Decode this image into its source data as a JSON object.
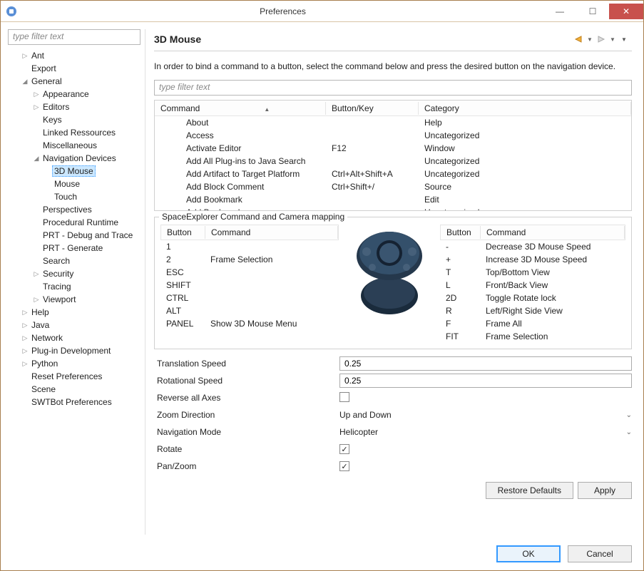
{
  "window": {
    "title": "Preferences"
  },
  "sidebar": {
    "filter_placeholder": "type filter text",
    "items": [
      {
        "label": "Ant",
        "indent": 1,
        "arrow": "▷"
      },
      {
        "label": "Export",
        "indent": 1,
        "arrow": ""
      },
      {
        "label": "General",
        "indent": 1,
        "arrow": "◢"
      },
      {
        "label": "Appearance",
        "indent": 2,
        "arrow": "▷"
      },
      {
        "label": "Editors",
        "indent": 2,
        "arrow": "▷"
      },
      {
        "label": "Keys",
        "indent": 2,
        "arrow": ""
      },
      {
        "label": "Linked Ressources",
        "indent": 2,
        "arrow": ""
      },
      {
        "label": "Miscellaneous",
        "indent": 2,
        "arrow": ""
      },
      {
        "label": "Navigation Devices",
        "indent": 2,
        "arrow": "◢"
      },
      {
        "label": "3D Mouse",
        "indent": 3,
        "arrow": "",
        "selected": true
      },
      {
        "label": "Mouse",
        "indent": 3,
        "arrow": ""
      },
      {
        "label": "Touch",
        "indent": 3,
        "arrow": ""
      },
      {
        "label": "Perspectives",
        "indent": 2,
        "arrow": ""
      },
      {
        "label": "Procedural Runtime",
        "indent": 2,
        "arrow": ""
      },
      {
        "label": "PRT - Debug and Trace",
        "indent": 2,
        "arrow": ""
      },
      {
        "label": "PRT - Generate",
        "indent": 2,
        "arrow": ""
      },
      {
        "label": "Search",
        "indent": 2,
        "arrow": ""
      },
      {
        "label": "Security",
        "indent": 2,
        "arrow": "▷"
      },
      {
        "label": "Tracing",
        "indent": 2,
        "arrow": ""
      },
      {
        "label": "Viewport",
        "indent": 2,
        "arrow": "▷"
      },
      {
        "label": "Help",
        "indent": 1,
        "arrow": "▷"
      },
      {
        "label": "Java",
        "indent": 1,
        "arrow": "▷"
      },
      {
        "label": "Network",
        "indent": 1,
        "arrow": "▷"
      },
      {
        "label": "Plug-in Development",
        "indent": 1,
        "arrow": "▷"
      },
      {
        "label": "Python",
        "indent": 1,
        "arrow": "▷"
      },
      {
        "label": "Reset Preferences",
        "indent": 1,
        "arrow": ""
      },
      {
        "label": "Scene",
        "indent": 1,
        "arrow": ""
      },
      {
        "label": "SWTBot Preferences",
        "indent": 1,
        "arrow": ""
      }
    ]
  },
  "page": {
    "title": "3D Mouse",
    "instructions": "In order to bind a command to a button, select the command below and press the desired button on the navigation device.",
    "filter_placeholder": "type filter text",
    "commands": {
      "headers": {
        "a": "Command",
        "b": "Button/Key",
        "c": "Category"
      },
      "rows": [
        {
          "a": "About",
          "b": "",
          "c": "Help"
        },
        {
          "a": "Access",
          "b": "",
          "c": "Uncategorized"
        },
        {
          "a": "Activate Editor",
          "b": "F12",
          "c": "Window"
        },
        {
          "a": "Add All Plug-ins to Java Search",
          "b": "",
          "c": "Uncategorized"
        },
        {
          "a": "Add Artifact to Target Platform",
          "b": "Ctrl+Alt+Shift+A",
          "c": "Uncategorized"
        },
        {
          "a": "Add Block Comment",
          "b": "Ctrl+Shift+/",
          "c": "Source"
        },
        {
          "a": "Add Bookmark",
          "b": "",
          "c": "Edit"
        },
        {
          "a": "Add Bookmark",
          "b": "",
          "c": "Uncategorized"
        }
      ]
    },
    "mapping": {
      "title": "SpaceExplorer Command and Camera mapping",
      "left": {
        "headers": {
          "a": "Button",
          "b": "Command"
        },
        "rows": [
          {
            "a": "1",
            "b": ""
          },
          {
            "a": "2",
            "b": "Frame Selection"
          },
          {
            "a": "ESC",
            "b": ""
          },
          {
            "a": "SHIFT",
            "b": ""
          },
          {
            "a": "CTRL",
            "b": ""
          },
          {
            "a": "ALT",
            "b": ""
          },
          {
            "a": "PANEL",
            "b": "Show 3D Mouse Menu"
          }
        ]
      },
      "right": {
        "headers": {
          "a": "Button",
          "b": "Command"
        },
        "rows": [
          {
            "a": "-",
            "b": "Decrease 3D Mouse Speed"
          },
          {
            "a": "+",
            "b": "Increase 3D Mouse Speed"
          },
          {
            "a": "T",
            "b": "Top/Bottom View"
          },
          {
            "a": "L",
            "b": "Front/Back View"
          },
          {
            "a": "2D",
            "b": "Toggle Rotate lock"
          },
          {
            "a": "R",
            "b": "Left/Right Side View"
          },
          {
            "a": "F",
            "b": "Frame All"
          },
          {
            "a": "FIT",
            "b": "Frame Selection"
          }
        ]
      }
    },
    "form": {
      "translation_speed_label": "Translation Speed",
      "translation_speed": "0.25",
      "rotational_speed_label": "Rotational Speed",
      "rotational_speed": "0.25",
      "reverse_axes_label": "Reverse all Axes",
      "reverse_axes": false,
      "zoom_dir_label": "Zoom Direction",
      "zoom_dir": "Up and Down",
      "nav_mode_label": "Navigation Mode",
      "nav_mode": "Helicopter",
      "rotate_label": "Rotate",
      "rotate": true,
      "panzoom_label": "Pan/Zoom",
      "panzoom": true
    },
    "buttons": {
      "restore": "Restore Defaults",
      "apply": "Apply"
    }
  },
  "footer": {
    "ok": "OK",
    "cancel": "Cancel"
  }
}
